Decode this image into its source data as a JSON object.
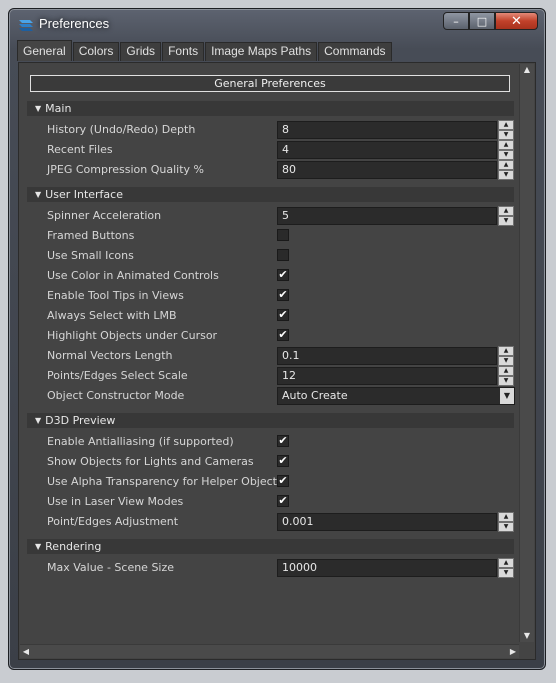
{
  "window": {
    "title": "Preferences",
    "min_glyph": "–",
    "max_glyph": "□",
    "close_glyph": "✕"
  },
  "tabs": [
    "General",
    "Colors",
    "Grids",
    "Fonts",
    "Image Maps Paths",
    "Commands"
  ],
  "header": "General Preferences",
  "sections": {
    "main": "Main",
    "ui": "User Interface",
    "d3d": "D3D Preview",
    "rendering": "Rendering"
  },
  "fields": {
    "history_depth": {
      "label": "History (Undo/Redo) Depth",
      "value": "8"
    },
    "recent_files": {
      "label": "Recent Files",
      "value": "4"
    },
    "jpeg_quality": {
      "label": "JPEG Compression Quality %",
      "value": "80"
    },
    "spinner_accel": {
      "label": "Spinner Acceleration",
      "value": "5"
    },
    "framed_buttons": {
      "label": "Framed Buttons",
      "checked": false
    },
    "small_icons": {
      "label": "Use Small Icons",
      "checked": false
    },
    "color_animated": {
      "label": "Use Color in Animated Controls",
      "checked": true
    },
    "tooltips": {
      "label": "Enable Tool Tips in Views",
      "checked": true
    },
    "select_lmb": {
      "label": "Always Select with LMB",
      "checked": true
    },
    "highlight_cursor": {
      "label": "Highlight Objects under Cursor",
      "checked": true
    },
    "normal_length": {
      "label": "Normal Vectors Length",
      "value": "0.1"
    },
    "select_scale": {
      "label": "Points/Edges Select Scale",
      "value": "12"
    },
    "constructor_mode": {
      "label": "Object Constructor Mode",
      "value": "Auto Create"
    },
    "antialias": {
      "label": "Enable Antialliasing (if supported)",
      "checked": true
    },
    "lights_cameras": {
      "label": "Show Objects for Lights and Cameras",
      "checked": true
    },
    "alpha_helpers": {
      "label": "Use Alpha Transparency for Helper Objects",
      "checked": true
    },
    "laser_view": {
      "label": "Use in Laser View Modes",
      "checked": true
    },
    "edges_adjust": {
      "label": "Point/Edges Adjustment",
      "value": "0.001"
    },
    "max_scene": {
      "label": "Max Value - Scene Size",
      "value": "10000"
    }
  },
  "glyphs": {
    "check": "✔",
    "collapse": "▼",
    "up": "▲",
    "down": "▼",
    "left": "◀",
    "right": "▶"
  },
  "colors": {
    "panel": "#444444",
    "field": "#2b2b2b",
    "section": "#383838",
    "close": "#c1412a"
  }
}
